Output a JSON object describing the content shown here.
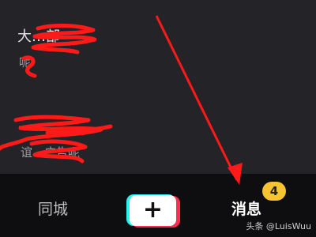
{
  "messages": [
    {
      "title": "大…部",
      "preview": "呢"
    },
    {
      "title": "…",
      "preview": "谊…广告呢"
    }
  ],
  "tabbar": {
    "city_label": "同城",
    "create_label": "+",
    "messages_label": "消息",
    "messages_badge": "4"
  },
  "watermark": "头条 @LuisWuu",
  "colors": {
    "annotation": "#ff1a1a",
    "badge": "#f7c431",
    "accent_cyan": "#25f4ee",
    "accent_red": "#fe2c55"
  }
}
